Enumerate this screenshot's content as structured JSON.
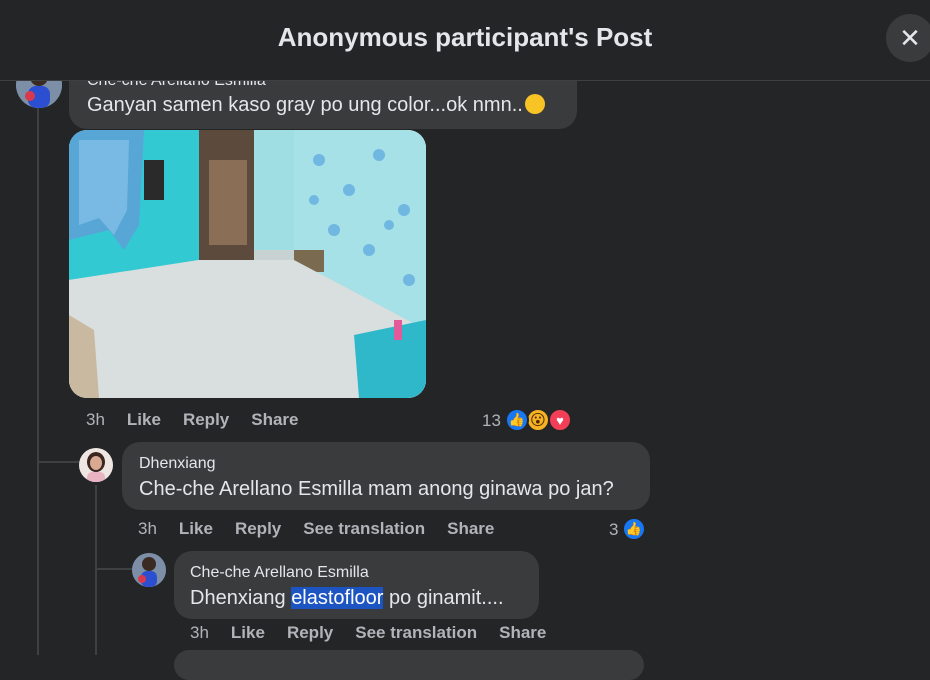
{
  "header": {
    "title": "Anonymous participant's Post",
    "close_icon": "close-icon"
  },
  "comments": [
    {
      "author": "Che-che Arellano Esmilla",
      "text": "Ganyan samen kaso gray po ung color...ok nmn..",
      "emoji": "pleading-face-emoji",
      "has_photo": true,
      "time": "3h",
      "actions": [
        "Like",
        "Reply",
        "Share"
      ],
      "reaction_count": "13",
      "reactions": [
        "like",
        "wow",
        "love"
      ]
    },
    {
      "author": "Dhenxiang",
      "text": "Che-che Arellano Esmilla mam anong ginawa po jan?",
      "time": "3h",
      "actions": [
        "Like",
        "Reply",
        "See translation",
        "Share"
      ],
      "reaction_count": "3",
      "reactions": [
        "like"
      ]
    },
    {
      "author": "Che-che Arellano Esmilla",
      "text_before": "Dhenxiang ",
      "text_highlight": "elastofloor",
      "text_after": " po ginamit....",
      "time": "3h",
      "actions": [
        "Like",
        "Reply",
        "See translation",
        "Share"
      ]
    }
  ],
  "colors": {
    "background": "#242526",
    "bubble": "#3a3b3c",
    "text": "#e4e6eb",
    "muted": "#b0b3b8",
    "like_blue": "#1877f2",
    "highlight": "#1c55c2"
  }
}
